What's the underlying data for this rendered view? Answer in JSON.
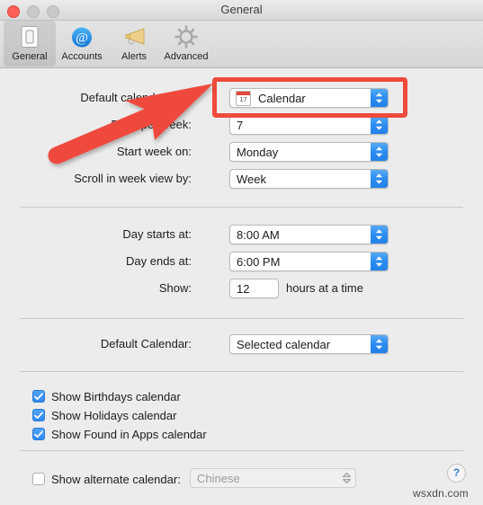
{
  "window": {
    "title": "General",
    "traffic_lights": [
      "close",
      "minimize",
      "zoom"
    ]
  },
  "toolbar": {
    "items": [
      {
        "label": "General",
        "icon": "general-icon",
        "selected": true
      },
      {
        "label": "Accounts",
        "icon": "at-sign-icon",
        "selected": false
      },
      {
        "label": "Alerts",
        "icon": "megaphone-icon",
        "selected": false
      },
      {
        "label": "Advanced",
        "icon": "gear-icon",
        "selected": false
      }
    ]
  },
  "form": {
    "rows": [
      {
        "label": "Default calendar app:",
        "value": "Calendar",
        "icon": "calendar-app-icon",
        "highlighted": true
      },
      {
        "label": "Days per week:",
        "value": "7"
      },
      {
        "label": "Start week on:",
        "value": "Monday"
      },
      {
        "label": "Scroll in week view by:",
        "value": "Week"
      },
      {
        "label": "Day starts at:",
        "value": "8:00 AM"
      },
      {
        "label": "Day ends at:",
        "value": "6:00 PM"
      }
    ],
    "show_row": {
      "label": "Show:",
      "value": "12",
      "suffix": "hours at a time"
    },
    "default_calendar": {
      "label": "Default Calendar:",
      "value": "Selected calendar"
    }
  },
  "checkboxes": [
    {
      "label": "Show Birthdays calendar",
      "checked": true
    },
    {
      "label": "Show Holidays calendar",
      "checked": true
    },
    {
      "label": "Show Found in Apps calendar",
      "checked": true
    }
  ],
  "alternate_calendar": {
    "label": "Show alternate calendar:",
    "checked": false,
    "value": "Chinese",
    "disabled": true
  },
  "help": {
    "label": "?"
  },
  "watermark": {
    "text": "wsxdn.com"
  },
  "annotations": {
    "highlight_color": "#ef4a3c",
    "arrow_color": "#ef4a3c"
  }
}
